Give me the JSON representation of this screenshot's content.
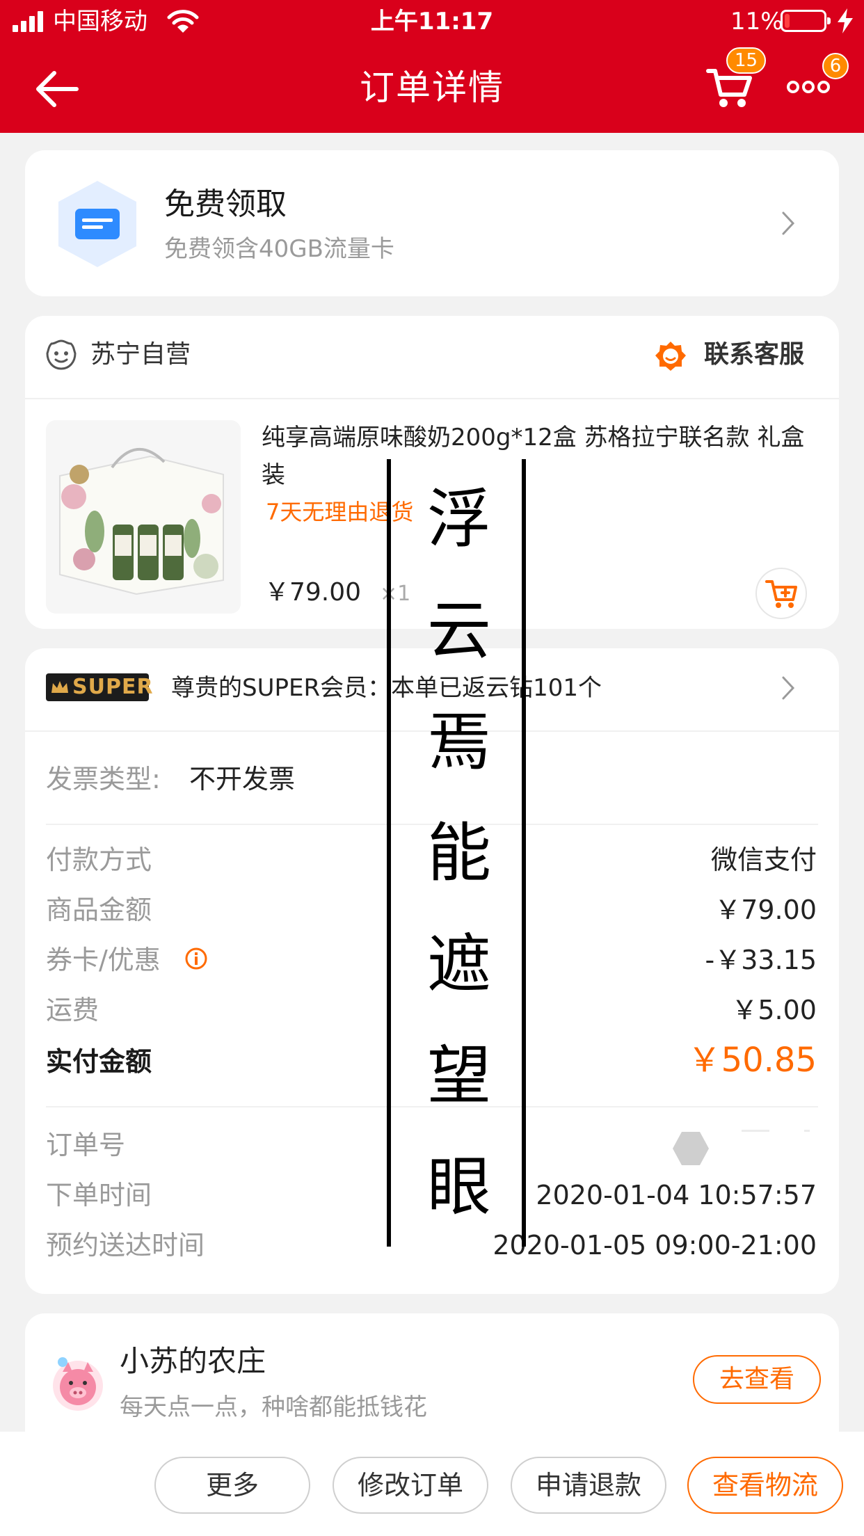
{
  "status_bar": {
    "carrier": "中国移动",
    "time": "上午11:17",
    "battery": "11%",
    "battery_level": 0.11
  },
  "header": {
    "title": "订单详情",
    "cart_badge": "15",
    "more_badge": "6"
  },
  "promo": {
    "title": "免费领取",
    "subtitle": "免费领含40GB流量卡"
  },
  "store": {
    "name": "苏宁自营",
    "service": "联系客服"
  },
  "product": {
    "title": "纯享高端原味酸奶200g*12盒 苏格拉宁联名款 礼盒装",
    "return_policy": "7天无理由退货",
    "price": "￥79.00",
    "quantity": "×1"
  },
  "super": {
    "logo": "SUPER",
    "text": "尊贵的SUPER会员：本单已返云钻101个"
  },
  "invoice": {
    "label": "发票类型:",
    "value": "不开发票"
  },
  "payment": [
    {
      "label": "付款方式",
      "value": "微信支付"
    },
    {
      "label": "商品金额",
      "value": "￥79.00"
    },
    {
      "label": "券卡/优惠",
      "value": "-￥33.15"
    },
    {
      "label": "运费",
      "value": "￥5.00"
    }
  ],
  "total": {
    "label": "实付金额",
    "value": "￥50.85"
  },
  "order_info": [
    {
      "label": "订单号",
      "value": ""
    },
    {
      "label": "下单时间",
      "value": "2020-01-04 10:57:57"
    },
    {
      "label": "预约送达时间",
      "value": "2020-01-05 09:00-21:00"
    }
  ],
  "farm": {
    "title": "小苏的农庄",
    "subtitle": "每天点一点，种啥都能抵钱花",
    "button": "去查看"
  },
  "bottom_buttons": [
    "更多",
    "修改订单",
    "申请退款",
    "查看物流"
  ],
  "overlay_text": [
    "浮",
    "云",
    "焉",
    "能",
    "遮",
    "望",
    "眼"
  ],
  "colors": {
    "brand_red": "#d9001b",
    "accent_orange": "#ff6a00",
    "page_bg": "#f2f2f2"
  }
}
